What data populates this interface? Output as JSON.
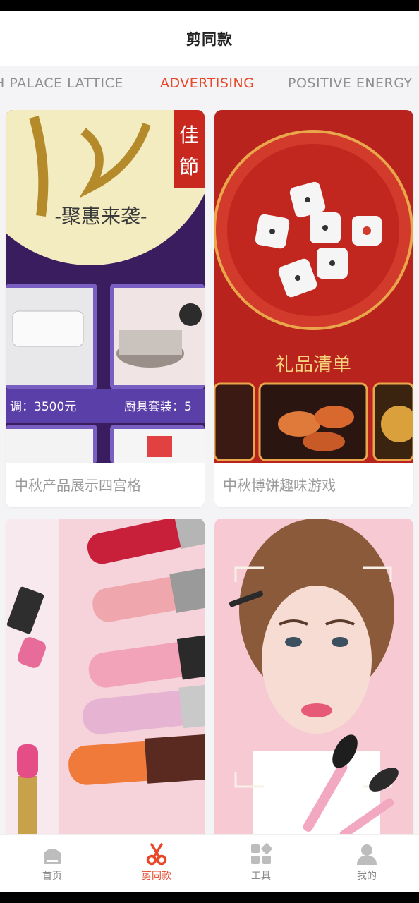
{
  "header": {
    "title": "剪同款"
  },
  "tabs": [
    {
      "label": "H PALACE LATTICE",
      "active": false
    },
    {
      "label": "ADVERTISING",
      "active": true
    },
    {
      "label": "POSITIVE ENERGY",
      "active": false
    }
  ],
  "cards": [
    {
      "caption": "中秋产品展示四宫格",
      "thumb_text": {
        "line1": "-聚惠来袭-",
        "price1": "调：3500元",
        "price2": "厨具套装：5"
      }
    },
    {
      "caption": "中秋博饼趣味游戏",
      "thumb_text": {
        "line1": "礼品清单"
      }
    },
    {
      "caption": ""
    },
    {
      "caption": ""
    }
  ],
  "bottom_nav": [
    {
      "label": "首页",
      "icon": "home-icon",
      "active": false
    },
    {
      "label": "剪同款",
      "icon": "scissors-icon",
      "active": true
    },
    {
      "label": "工具",
      "icon": "tools-grid-icon",
      "active": false
    },
    {
      "label": "我的",
      "icon": "user-icon",
      "active": false
    }
  ],
  "colors": {
    "accent": "#e8472a",
    "text_muted": "#8f8f8f",
    "background": "#f4f4f6"
  }
}
